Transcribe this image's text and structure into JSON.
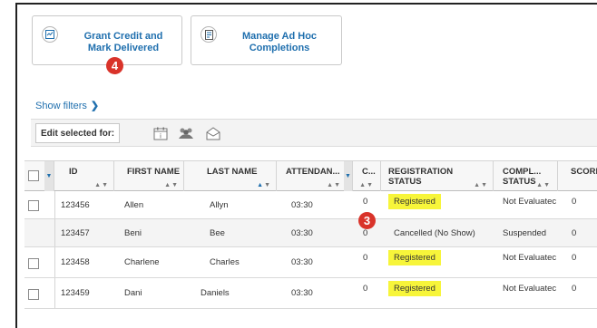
{
  "actions": {
    "grant_label": "Grant Credit and Mark Delivered",
    "manage_label": "Manage Ad Hoc Completions",
    "step_badge_grant": "4",
    "step_badge_table": "3"
  },
  "filters": {
    "show_filters": "Show filters"
  },
  "edit_bar": {
    "label": "Edit selected for:",
    "icons": [
      "calendar-icon",
      "users-icon",
      "email-icon"
    ]
  },
  "table": {
    "columns": [
      {
        "key": "id",
        "label": "ID"
      },
      {
        "key": "first_name",
        "label": "FIRST NAME"
      },
      {
        "key": "last_name",
        "label": "LAST NAME"
      },
      {
        "key": "attendance",
        "label": "ATTENDAN..."
      },
      {
        "key": "c",
        "label": "C..."
      },
      {
        "key": "registration_status",
        "label": "REGISTRATION STATUS"
      },
      {
        "key": "completion_status",
        "label": "COMPL... STATUS"
      },
      {
        "key": "score",
        "label": "SCORE"
      }
    ],
    "rows": [
      {
        "id": "123456",
        "first_name": "Allen",
        "last_name": "Allyn",
        "attendance": "03:30",
        "c": "0",
        "registration_status": "Registered",
        "completion_status": "Not Evaluatec",
        "score": "0"
      },
      {
        "id": "123457",
        "first_name": "Beni",
        "last_name": "Bee",
        "attendance": "03:30",
        "c": "0",
        "registration_status": "Cancelled (No Show)",
        "completion_status": "Suspended",
        "score": "0"
      },
      {
        "id": "123458",
        "first_name": "Charlene",
        "last_name": "Charles",
        "attendance": "03:30",
        "c": "0",
        "registration_status": "Registered",
        "completion_status": "Not Evaluatec",
        "score": "0"
      },
      {
        "id": "123459",
        "first_name": "Dani",
        "last_name": "Daniels",
        "attendance": "03:30",
        "c": "0",
        "registration_status": "Registered",
        "completion_status": "Not Evaluatec",
        "score": "0"
      }
    ]
  },
  "colors": {
    "link_blue": "#1f6fae",
    "badge_red": "#d9332a",
    "highlight_yellow": "#f7f53a"
  }
}
